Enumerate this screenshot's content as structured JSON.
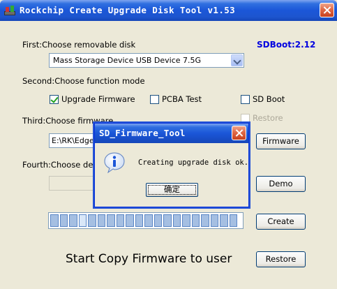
{
  "window": {
    "title": "Rockchip Create Upgrade Disk Tool v1.53",
    "icon": "app-icon",
    "close_icon": "close-icon"
  },
  "step1": {
    "label": "First:Choose removable disk",
    "disk_selected": "Mass Storage Device USB Device   7.5G"
  },
  "sdboot_version": "SDBoot:2.12",
  "step2": {
    "label": "Second:Choose function mode",
    "options": [
      {
        "label": "Upgrade Firmware",
        "checked": true
      },
      {
        "label": "PCBA Test",
        "checked": false
      },
      {
        "label": "SD Boot",
        "checked": false
      }
    ],
    "restore_label": "Restore"
  },
  "step3": {
    "label": "Third:Choose firmware",
    "path_value": "E:\\RK\\Edge\\",
    "button": "Firmware"
  },
  "step4": {
    "label": "Fourth:Choose demo",
    "demo_value": "",
    "button": "Demo"
  },
  "progress": {
    "segments_total": 20,
    "segments_filled": 20,
    "highlighted_segment": 3
  },
  "create_button": "Create",
  "copy_label": "Start Copy Firmware to user",
  "restore_button": "Restore",
  "dialog": {
    "title": "SD_Firmware_Tool",
    "icon": "info-icon",
    "message": "Creating upgrade disk ok.",
    "ok_button": "确定"
  },
  "colors": {
    "accent_title": "#1b56d8",
    "sdboot_text": "#0000e0",
    "progress_fill": "#a5bfe2",
    "window_bg": "#ece9d8"
  }
}
